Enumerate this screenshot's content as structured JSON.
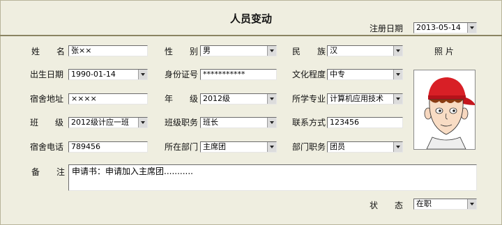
{
  "window": {
    "title": "人员变动"
  },
  "register": {
    "label": "注册日期",
    "value": "2013-05-14"
  },
  "photo_label": "照 片",
  "fields": {
    "name": {
      "label": "姓　　名",
      "value": "张××"
    },
    "gender": {
      "label": "性　　别",
      "value": "男"
    },
    "ethnicity": {
      "label": "民　　族",
      "value": "汉"
    },
    "birth": {
      "label": "出生日期",
      "value": "1990-01-14"
    },
    "id_number": {
      "label": "身份证号",
      "value": "***********"
    },
    "education": {
      "label": "文化程度",
      "value": "中专"
    },
    "dorm_address": {
      "label": "宿舍地址",
      "value": "××××"
    },
    "grade": {
      "label": "年　　级",
      "value": "2012级"
    },
    "major": {
      "label": "所学专业",
      "value": "计算机应用技术"
    },
    "class": {
      "label": "班　　级",
      "value": "2012级计应一班"
    },
    "class_post": {
      "label": "班级职务",
      "value": "班长"
    },
    "contact": {
      "label": "联系方式",
      "value": "123456"
    },
    "dorm_phone": {
      "label": "宿舍电话",
      "value": "789456"
    },
    "department": {
      "label": "所在部门",
      "value": "主席团"
    },
    "dept_post": {
      "label": "部门职务",
      "value": "团员"
    },
    "remark": {
      "label": "备　　注",
      "value": "申请书：申请加入主席团..........."
    },
    "status": {
      "label": "状　　态",
      "value": "在职"
    }
  }
}
